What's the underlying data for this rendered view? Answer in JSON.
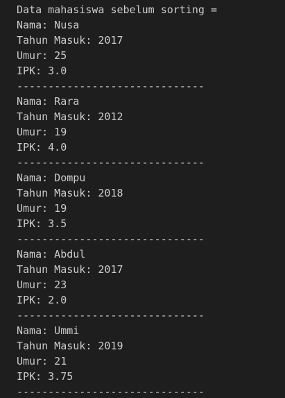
{
  "terminal": {
    "lines": [
      "Data mahasiswa sebelum sorting =",
      "Nama: Nusa",
      "Tahun Masuk: 2017",
      "Umur: 25",
      "IPK: 3.0",
      "------------------------------",
      "Nama: Rara",
      "Tahun Masuk: 2012",
      "Umur: 19",
      "IPK: 4.0",
      "------------------------------",
      "Nama: Dompu",
      "Tahun Masuk: 2018",
      "Umur: 19",
      "IPK: 3.5",
      "------------------------------",
      "Nama: Abdul",
      "Tahun Masuk: 2017",
      "Umur: 23",
      "IPK: 2.0",
      "------------------------------",
      "Nama: Ummi",
      "Tahun Masuk: 2019",
      "Umur: 21",
      "IPK: 3.75",
      "------------------------------"
    ]
  }
}
